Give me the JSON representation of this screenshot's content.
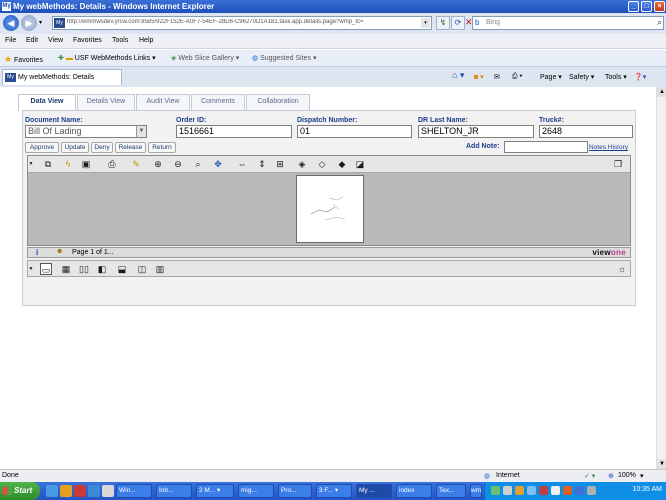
{
  "window": {
    "title": "My webMethods: Details - Windows Internet Explorer"
  },
  "address": {
    "url": "http://wmmwsdev.yrcw.com:8585/922F152E-A0F7-54EF-28D6-C96270D1A181.task.app.details.page?wmp_tc=",
    "search_placeholder": "Bing"
  },
  "menu": [
    "File",
    "Edit",
    "View",
    "Favorites",
    "Tools",
    "Help"
  ],
  "favorites": {
    "label": "Favorites",
    "items": [
      "USF WebMethods Links ▾",
      "Web Slice Gallery ▾",
      "Suggested Sites ▾"
    ]
  },
  "tab": {
    "label": "My webMethods: Details",
    "tools": [
      "Page ▾",
      "Safety ▾",
      "Tools ▾"
    ]
  },
  "app_tabs": [
    "Data View",
    "Details View",
    "Audit View",
    "Comments",
    "Collaboration"
  ],
  "fields": {
    "document_name": {
      "label": "Document Name:",
      "value": "Bill Of Lading"
    },
    "order_id": {
      "label": "Order ID:",
      "value": "1516661"
    },
    "dispatch_number": {
      "label": "Dispatch Number:",
      "value": "01"
    },
    "dr_last_name": {
      "label": "DR Last Name:",
      "value": "SHELTON_JR"
    },
    "truck": {
      "label": "Truck#:",
      "value": "2648"
    }
  },
  "actions": [
    "Approve",
    "Update",
    "Deny",
    "Release",
    "Return"
  ],
  "note": {
    "label": "Add Note:",
    "history_link": "Notes History"
  },
  "viewer": {
    "page_status": "Page 1 of 1...",
    "logo_a": "view",
    "logo_b": "one"
  },
  "status": {
    "left": "Done",
    "zone": "Internet",
    "zoom": "100%"
  },
  "taskbar": {
    "start": "Start",
    "buttons": [
      "Win...",
      "Inb...",
      "2 M... ▾",
      "mig...",
      "Pro...",
      "3 F... ▾",
      "My ...",
      "index",
      "Tex...",
      "wmi..."
    ],
    "clock": "10:35 AM"
  },
  "colors": {
    "accent": "#1c3c8c",
    "titlebar": "#2a5cc9",
    "taskbar": "#2454c6"
  }
}
